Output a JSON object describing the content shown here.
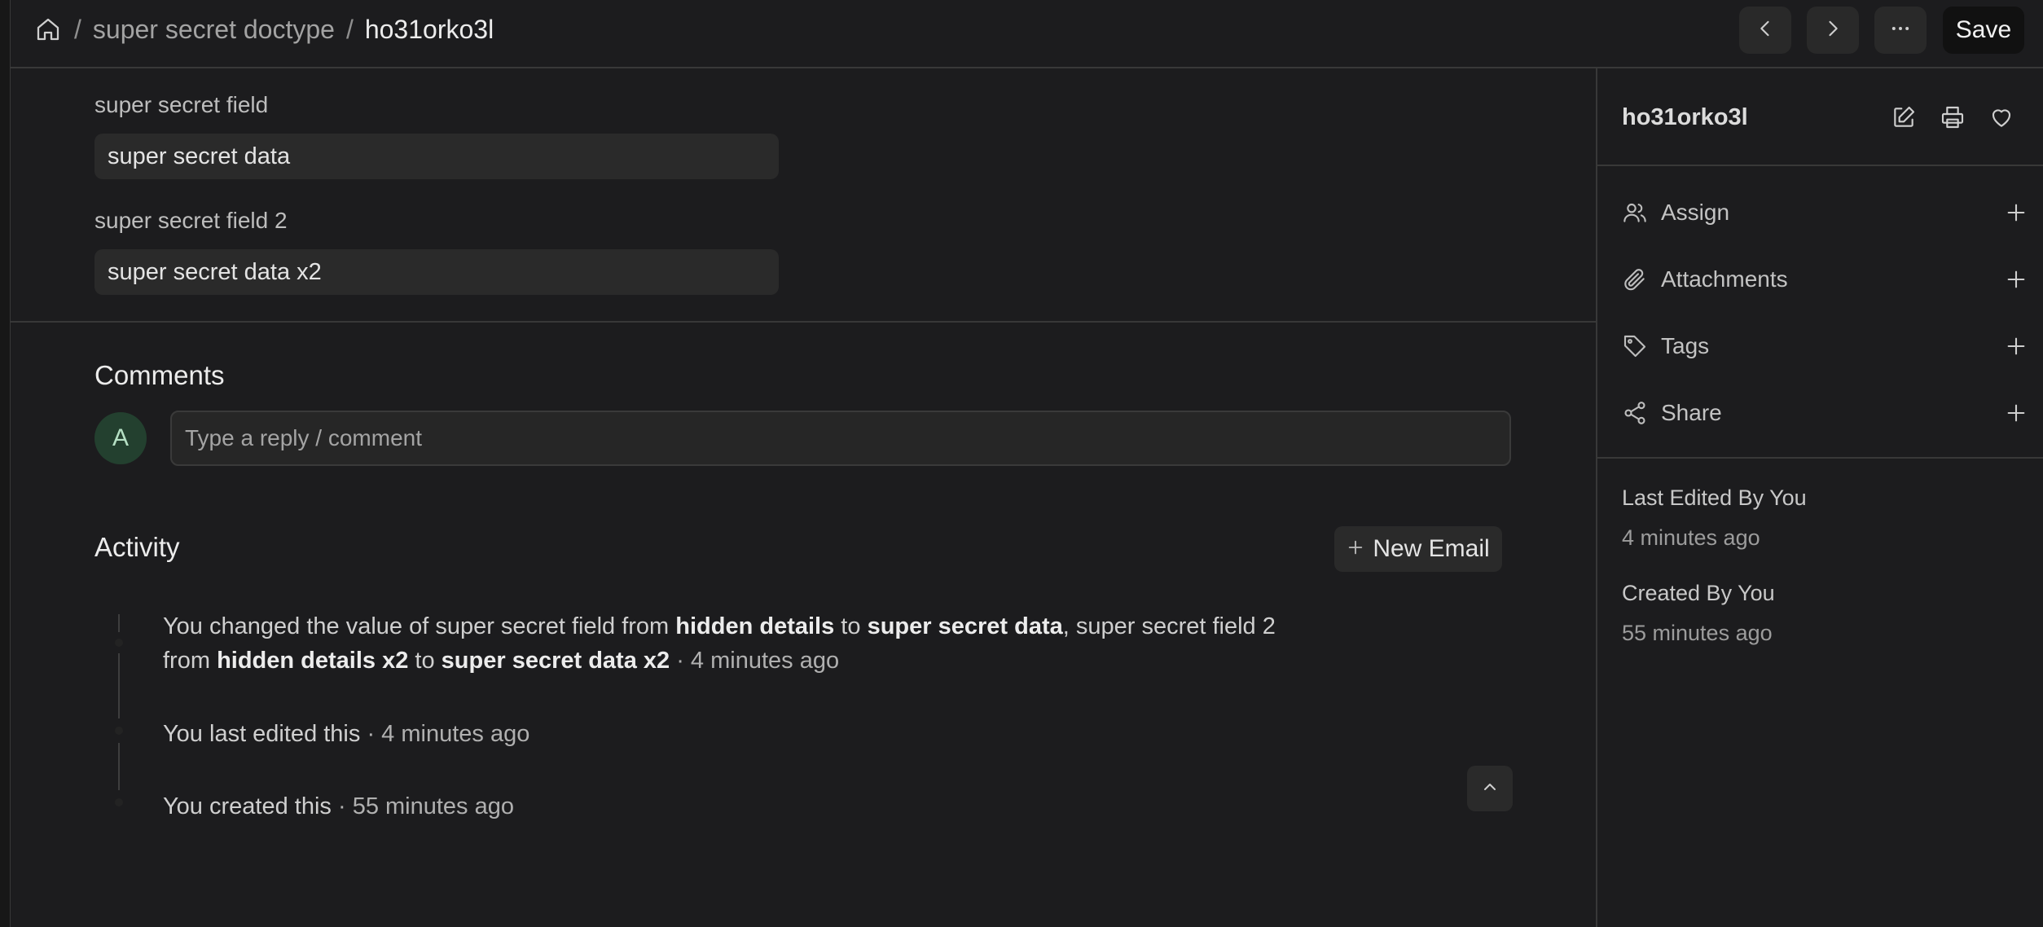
{
  "breadcrumb": {
    "doctype": "super secret doctype",
    "separator": "/",
    "record": "ho31orko3l"
  },
  "toolbar": {
    "save_label": "Save",
    "prev_icon": "chevron-left-icon",
    "next_icon": "chevron-right-icon",
    "more_icon": "ellipsis-icon"
  },
  "form": {
    "fields": [
      {
        "label": "super secret field",
        "value": "super secret data"
      },
      {
        "label": "super secret field 2",
        "value": "super secret data x2"
      }
    ]
  },
  "comments": {
    "title": "Comments",
    "avatar_initial": "A",
    "placeholder": "Type a reply / comment"
  },
  "activity": {
    "title": "Activity",
    "new_email_label": "New Email",
    "items": [
      {
        "p1": "You changed the value of super secret field from ",
        "b1": "hidden details",
        "p2": " to ",
        "b2": "super secret data",
        "p3": ", super secret field 2 from ",
        "b3": "hidden details x2",
        "p4": " to ",
        "b4": "super secret data x2",
        "time": " · 4 minutes ago"
      },
      {
        "text": "You last edited this",
        "time": " · 4 minutes ago"
      },
      {
        "text": "You created this",
        "time": " · 55 minutes ago"
      }
    ]
  },
  "sidebar": {
    "title": "ho31orko3l",
    "actions": [
      {
        "label": "Assign",
        "icon": "users-icon"
      },
      {
        "label": "Attachments",
        "icon": "paperclip-icon"
      },
      {
        "label": "Tags",
        "icon": "tag-icon"
      },
      {
        "label": "Share",
        "icon": "share-icon"
      }
    ],
    "last_edited_label": "Last Edited By You",
    "last_edited_time": "4 minutes ago",
    "created_label": "Created By You",
    "created_time": "55 minutes ago"
  },
  "colors": {
    "background": "#1c1c1e",
    "input_background": "#2a2a2a",
    "avatar_background": "#23402f",
    "save_background": "#111111"
  }
}
